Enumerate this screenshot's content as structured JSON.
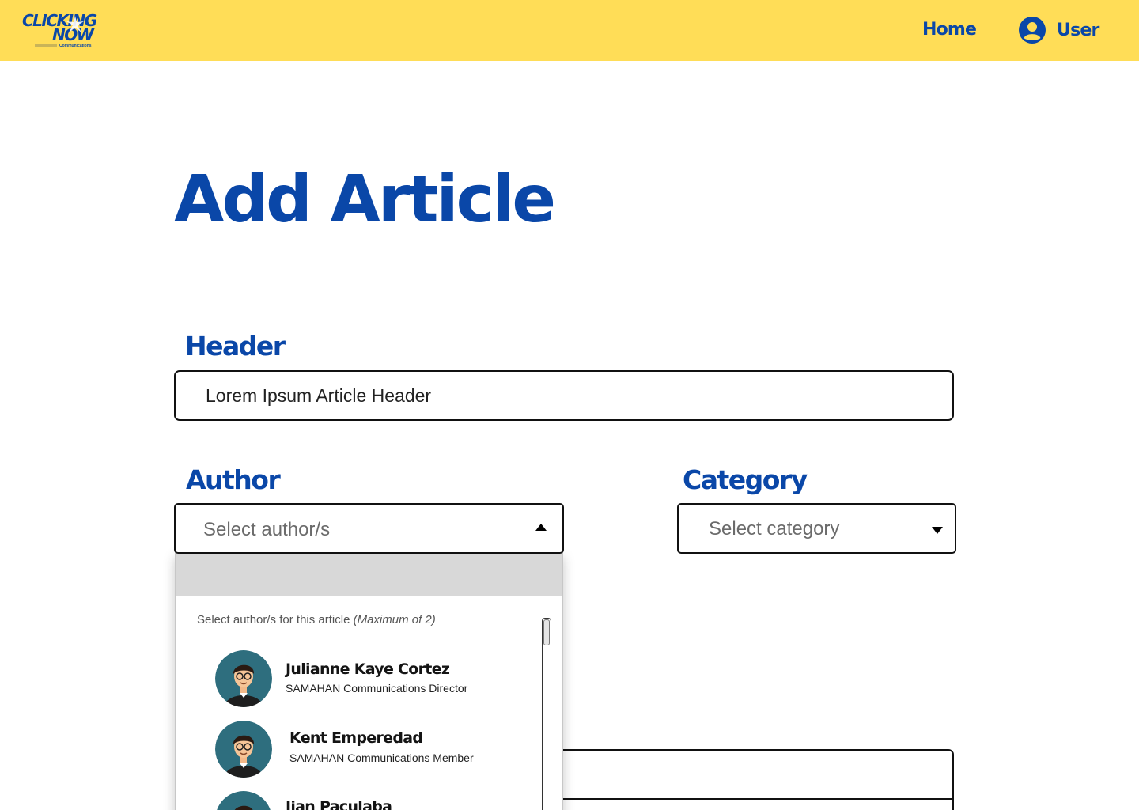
{
  "nav": {
    "logo_line1": "CLICKING",
    "logo_line2": "NOW",
    "logo_tagline": "Communications",
    "home_label": "Home",
    "user_label": "User"
  },
  "page": {
    "title": "Add Article"
  },
  "form": {
    "header_label": "Header",
    "header_value": "Lorem Ipsum Article Header",
    "author_label": "Author",
    "author_placeholder": "Select author/s",
    "category_label": "Category",
    "category_placeholder": "Select category"
  },
  "author_dropdown": {
    "hint": "Select author/s for this article",
    "hint_note": "(Maximum of 2)",
    "authors": [
      {
        "name": "Julianne Kaye Cortez",
        "role": "SAMAHAN Communications Director"
      },
      {
        "name": "Kent Emperedad",
        "role": "SAMAHAN Communications Member"
      },
      {
        "name": "Jian Paculaba",
        "role": ""
      }
    ]
  },
  "colors": {
    "brand_yellow": "#FFDD57",
    "brand_blue": "#0A47A8",
    "avatar_bg": "#2E6E7E",
    "dropdown_band": "#D8D8D8"
  },
  "icons": {
    "user": "user-circle-icon",
    "author_caret": "caret-up-icon",
    "category_caret": "caret-down-icon",
    "avatar": "avatar-icon"
  }
}
